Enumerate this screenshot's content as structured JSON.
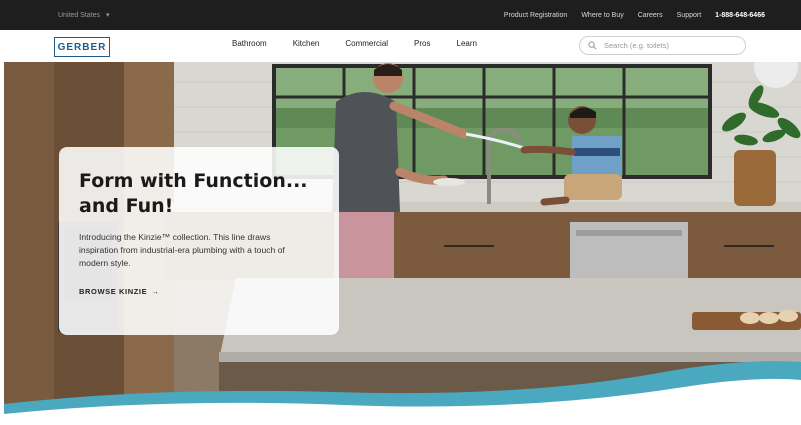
{
  "utility": {
    "region": "United States",
    "links": [
      "Product Registration",
      "Where to Buy",
      "Careers",
      "Support"
    ],
    "phone": "1-888-648-6466"
  },
  "nav": {
    "logo": "GERBER",
    "links": [
      "Bathroom",
      "Kitchen",
      "Commercial",
      "Pros",
      "Learn"
    ],
    "search_placeholder": "Search (e.g. toilets)"
  },
  "hero": {
    "title": "Form with Function... and Fun!",
    "body": "Introducing the Kinzie™ collection. This line draws inspiration from industrial-era plumbing with a touch of modern style.",
    "cta": "BROWSE KINZIE",
    "cta_arrow": "→"
  },
  "colors": {
    "brand": "#1f5b8a",
    "utility_bg": "#1e1e1e",
    "wave": "#4aa9bf"
  }
}
